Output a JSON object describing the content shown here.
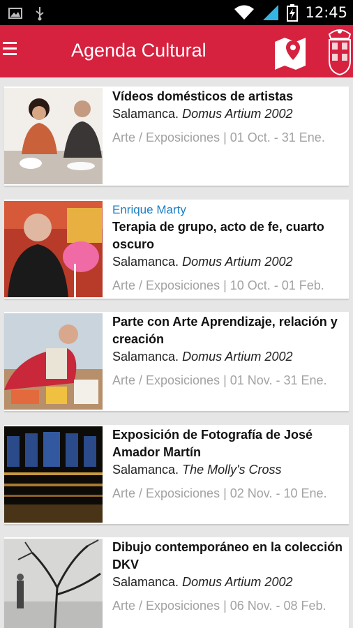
{
  "status_bar": {
    "time": "12:45"
  },
  "app_bar": {
    "title": "Agenda Cultural"
  },
  "events": [
    {
      "subtitle": "",
      "title": "Vídeos domésticos de artistas",
      "city": "Salamanca.",
      "venue": "Domus Artium 2002",
      "meta": "Arte / Exposiciones | 01 Oct. - 31 Ene."
    },
    {
      "subtitle": "Enrique Marty",
      "title": "Terapia de grupo, acto de fe, cuarto oscuro",
      "city": "Salamanca.",
      "venue": "Domus Artium 2002",
      "meta": "Arte / Exposiciones | 10 Oct. - 01 Feb."
    },
    {
      "subtitle": "",
      "title": "Parte con Arte Aprendizaje, relación y creación",
      "city": "Salamanca.",
      "venue": "Domus Artium 2002",
      "meta": "Arte / Exposiciones | 01 Nov. - 31 Ene."
    },
    {
      "subtitle": "",
      "title": "Exposición de Fotografía de José Amador Martín",
      "city": "Salamanca.",
      "venue": "The Molly's Cross",
      "meta": "Arte / Exposiciones | 02 Nov. - 10 Ene."
    },
    {
      "subtitle": "",
      "title": "Dibujo contemporáneo en la colección DKV",
      "city": "Salamanca.",
      "venue": "Domus Artium 2002",
      "meta": "Arte / Exposiciones | 06 Nov. - 08 Feb."
    }
  ],
  "colors": {
    "app_bar": "#d6213f",
    "subtitle": "#1b7fc4",
    "meta": "#a2a2a2",
    "background": "#e6e6e6"
  },
  "icons": [
    "image-icon",
    "usb-icon",
    "wifi-icon",
    "signal-icon",
    "battery-icon",
    "menu-icon",
    "map-pin-icon",
    "coat-of-arms-icon"
  ]
}
